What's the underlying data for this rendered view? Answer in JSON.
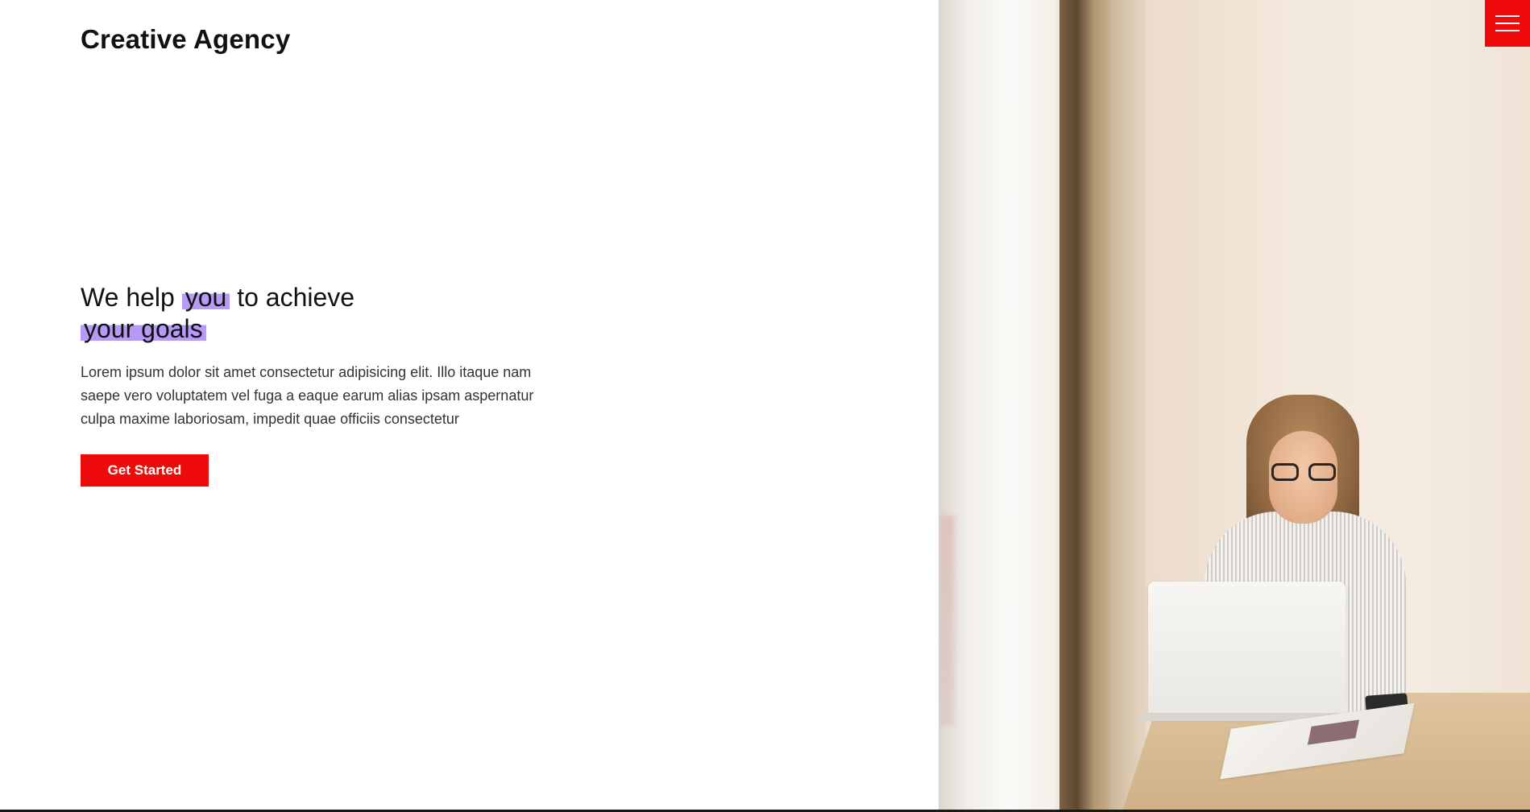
{
  "brand": {
    "name": "Creative Agency"
  },
  "hero": {
    "headline_part1": "We help",
    "headline_highlight1": "you",
    "headline_part2": "to achieve",
    "headline_highlight2": "your goals",
    "description": "Lorem ipsum dolor sit amet consectetur adipisicing elit. Illo itaque nam saepe vero voluptatem vel fuga a eaque earum alias ipsam aspernatur culpa maxime laboriosam, impedit quae officiis consectetur",
    "cta_label": "Get Started"
  },
  "menu": {
    "icon": "hamburger-menu-icon"
  },
  "colors": {
    "accent": "#ee0a0a",
    "highlight": "#b79af5",
    "text": "#111111"
  }
}
